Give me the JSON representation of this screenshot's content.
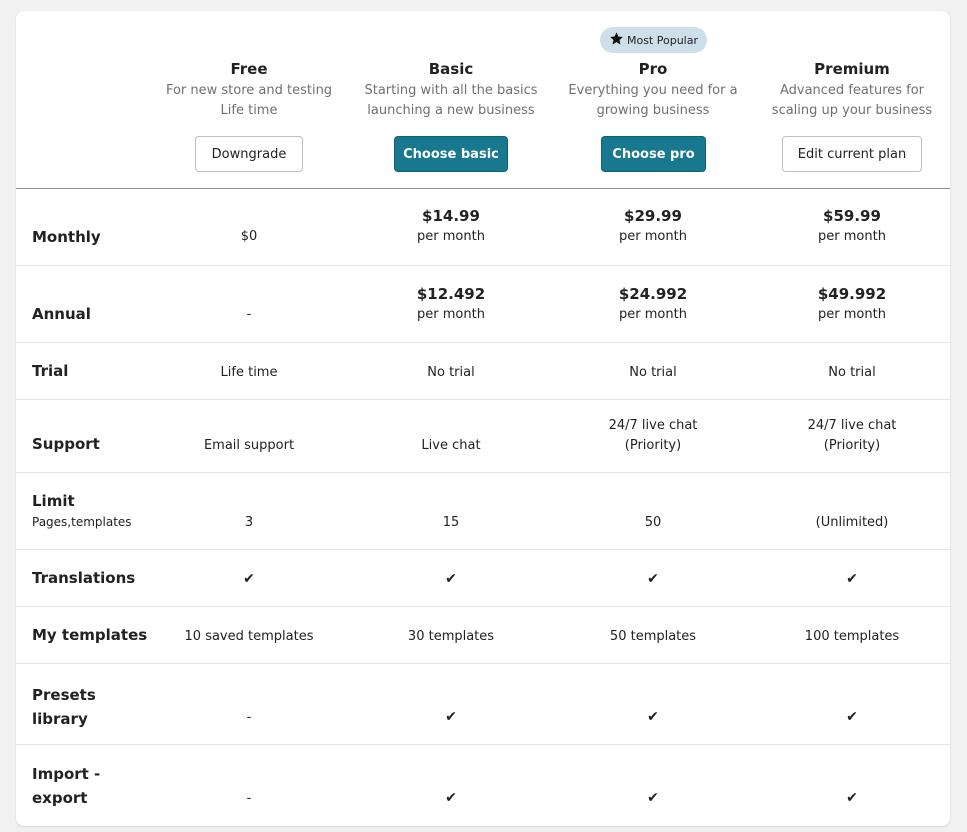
{
  "badge": {
    "icon": "star-icon",
    "label": "Most Popular"
  },
  "plans": [
    {
      "name": "Free",
      "desc1": "For new store and testing",
      "desc2": "Life time",
      "button": "Downgrade"
    },
    {
      "name": "Basic",
      "desc1": "Starting with all the basics",
      "desc2": "launching a new business",
      "button": "Choose basic"
    },
    {
      "name": "Pro",
      "desc1": "Everything you need for a",
      "desc2": "growing business",
      "button": "Choose pro"
    },
    {
      "name": "Premium",
      "desc1": "Advanced features for",
      "desc2": "scaling up your business",
      "button": "Edit current plan"
    }
  ],
  "rows": {
    "monthly": {
      "label": "Monthly",
      "values": [
        "$0",
        "$14.99",
        "$29.99",
        "$59.99"
      ],
      "unit": "per month"
    },
    "annual": {
      "label": "Annual",
      "values": [
        "-",
        "$12.492",
        "$24.992",
        "$49.992"
      ],
      "unit": "per month"
    },
    "trial": {
      "label": "Trial",
      "values": [
        "Life time",
        "No trial",
        "No trial",
        "No trial"
      ]
    },
    "support": {
      "label": "Support",
      "values": [
        "Email support",
        "Live chat",
        "24/7 live chat",
        "24/7 live chat"
      ],
      "priority": "(Priority)"
    },
    "limit": {
      "label": "Limit",
      "sublabel": "Pages,templates",
      "values": [
        "3",
        "15",
        "50",
        "(Unlimited)"
      ]
    },
    "translations": {
      "label": "Translations",
      "check": "✔"
    },
    "my_templates": {
      "label": "My templates",
      "values": [
        "10 saved templates",
        "30 templates",
        "50 templates",
        "100 templates"
      ]
    },
    "presets": {
      "label1": "Presets",
      "label2": "library",
      "dash": "-",
      "check": "✔"
    },
    "import_export": {
      "label1": "Import -",
      "label2": "export",
      "dash": "-",
      "check": "✔"
    }
  }
}
